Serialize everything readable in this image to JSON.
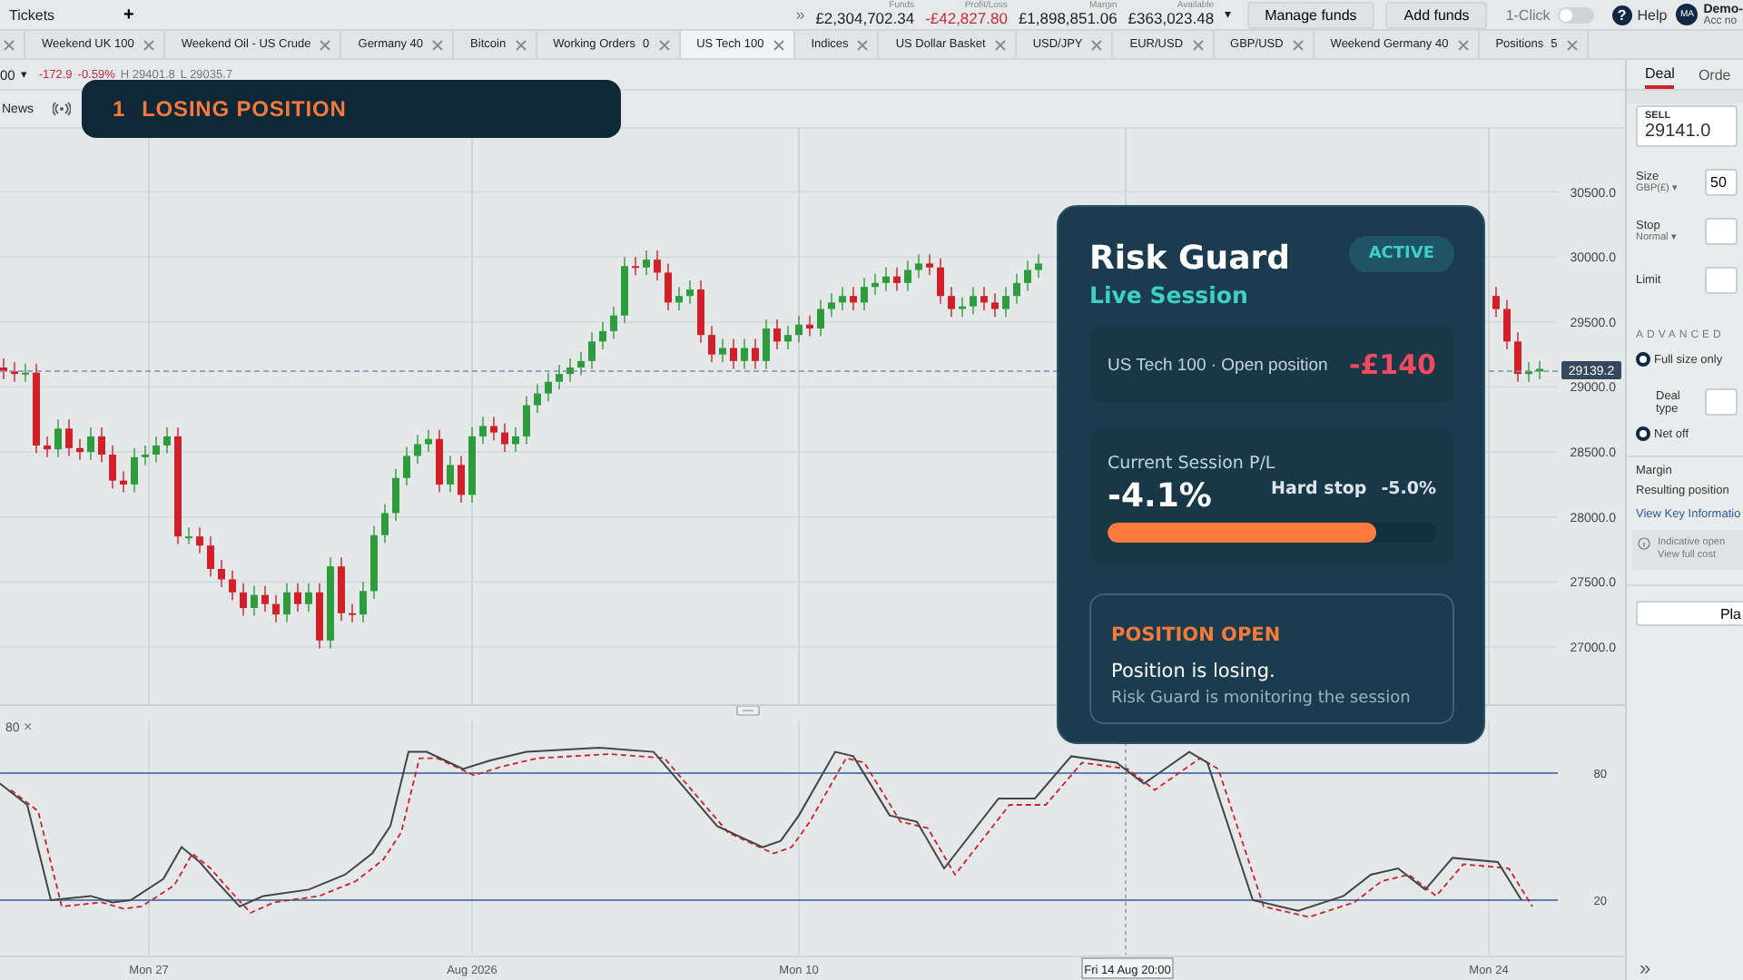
{
  "top_bar": {
    "tickets_label": "Tickets",
    "add_tab": "+",
    "overflow": "»",
    "stats": [
      {
        "label": "Funds",
        "value": "£2,304,702.34",
        "negative": false
      },
      {
        "label": "Profit/Loss",
        "value": "-£42,827.80",
        "negative": true
      },
      {
        "label": "Margin",
        "value": "£1,898,851.06",
        "negative": false
      },
      {
        "label": "Available",
        "value": "£363,023.48",
        "negative": false
      }
    ],
    "stats_caret": "▾",
    "buttons": [
      "Manage funds",
      "Add funds"
    ],
    "one_click": {
      "label": "1-Click",
      "on": false
    },
    "help": {
      "icon": "?",
      "label": "Help"
    },
    "account": {
      "initials": "MA",
      "name": "Demo-",
      "sub": "Acc no"
    }
  },
  "tabs": [
    {
      "label": "Weekend UK 100",
      "selected": false
    },
    {
      "label": "Weekend Oil - US Crude",
      "selected": false
    },
    {
      "label": "Germany 40",
      "selected": false
    },
    {
      "label": "Bitcoin",
      "selected": false
    },
    {
      "label": "Working Orders",
      "count": "0",
      "selected": false
    },
    {
      "label": "US Tech 100",
      "selected": true
    },
    {
      "label": "Indices",
      "selected": false
    },
    {
      "label": "US Dollar Basket",
      "selected": false
    },
    {
      "label": "USD/JPY",
      "selected": false
    },
    {
      "label": "EUR/USD",
      "selected": false
    },
    {
      "label": "GBP/USD",
      "selected": false
    },
    {
      "label": "Weekend Germany 40",
      "selected": false
    },
    {
      "label": "Positions",
      "count": "5",
      "selected": false
    }
  ],
  "instrument_bar": {
    "price_tail": "00",
    "caret": "▾",
    "change": "-172.9",
    "change_pct": "-0.59%",
    "high": "H 29401.8",
    "low": "L 29035.7"
  },
  "chart_toolbar": {
    "news": "News"
  },
  "banner": {
    "number": "1",
    "text": "LOSING POSITION"
  },
  "chart": {
    "chart_data": {
      "type": "candlestick",
      "grid": true,
      "yticks": [
        {
          "value": 30500,
          "label": "30500.0"
        },
        {
          "value": 30000,
          "label": "30000.0"
        },
        {
          "value": 29500,
          "label": "29500.0"
        },
        {
          "value": 29000,
          "label": "29000.0"
        },
        {
          "value": 28500,
          "label": "28500.0"
        },
        {
          "value": 28000,
          "label": "28000.0"
        },
        {
          "value": 27500,
          "label": "27500.0"
        },
        {
          "value": 27000,
          "label": "27000.0"
        }
      ],
      "ylim": [
        26560,
        30986
      ],
      "ohlc": [
        [
          29150,
          29220,
          29060,
          29120
        ],
        [
          29120,
          29190,
          29040,
          29100
        ],
        [
          29100,
          29180,
          29040,
          29110
        ],
        [
          29110,
          29180,
          28490,
          28550
        ],
        [
          28550,
          28620,
          28460,
          28520
        ],
        [
          28520,
          28750,
          28460,
          28680
        ],
        [
          28680,
          28750,
          28470,
          28530
        ],
        [
          28530,
          28600,
          28440,
          28500
        ],
        [
          28500,
          28690,
          28440,
          28620
        ],
        [
          28620,
          28690,
          28420,
          28480
        ],
        [
          28480,
          28550,
          28220,
          28280
        ],
        [
          28280,
          28350,
          28190,
          28250
        ],
        [
          28250,
          28530,
          28190,
          28460
        ],
        [
          28460,
          28550,
          28400,
          28480
        ],
        [
          28480,
          28620,
          28420,
          28550
        ],
        [
          28550,
          28690,
          28490,
          28620
        ],
        [
          28620,
          28690,
          27790,
          27850
        ],
        [
          27850,
          27920,
          27790,
          27850
        ],
        [
          27850,
          27920,
          27720,
          27780
        ],
        [
          27780,
          27850,
          27540,
          27600
        ],
        [
          27600,
          27670,
          27460,
          27520
        ],
        [
          27520,
          27590,
          27360,
          27420
        ],
        [
          27420,
          27490,
          27240,
          27300
        ],
        [
          27300,
          27470,
          27240,
          27400
        ],
        [
          27400,
          27470,
          27270,
          27330
        ],
        [
          27330,
          27400,
          27190,
          27250
        ],
        [
          27250,
          27490,
          27190,
          27420
        ],
        [
          27420,
          27490,
          27270,
          27330
        ],
        [
          27330,
          27490,
          27270,
          27420
        ],
        [
          27420,
          27490,
          26990,
          27050
        ],
        [
          27050,
          27690,
          26990,
          27620
        ],
        [
          27620,
          27690,
          27200,
          27260
        ],
        [
          27260,
          27330,
          27190,
          27250
        ],
        [
          27250,
          27500,
          27190,
          27430
        ],
        [
          27430,
          27930,
          27370,
          27860
        ],
        [
          27860,
          28100,
          27800,
          28030
        ],
        [
          28030,
          28370,
          27970,
          28300
        ],
        [
          28300,
          28540,
          28240,
          28470
        ],
        [
          28470,
          28630,
          28410,
          28560
        ],
        [
          28560,
          28670,
          28500,
          28600
        ],
        [
          28600,
          28670,
          28190,
          28250
        ],
        [
          28250,
          28470,
          28190,
          28400
        ],
        [
          28400,
          28470,
          28110,
          28170
        ],
        [
          28170,
          28690,
          28110,
          28620
        ],
        [
          28620,
          28770,
          28560,
          28700
        ],
        [
          28700,
          28770,
          28590,
          28650
        ],
        [
          28650,
          28720,
          28500,
          28560
        ],
        [
          28560,
          28690,
          28500,
          28620
        ],
        [
          28620,
          28930,
          28560,
          28860
        ],
        [
          28860,
          29020,
          28800,
          28950
        ],
        [
          28950,
          29110,
          28890,
          29040
        ],
        [
          29040,
          29170,
          28980,
          29100
        ],
        [
          29100,
          29220,
          29040,
          29150
        ],
        [
          29150,
          29270,
          29090,
          29200
        ],
        [
          29200,
          29420,
          29140,
          29350
        ],
        [
          29350,
          29500,
          29290,
          29430
        ],
        [
          29430,
          29620,
          29370,
          29550
        ],
        [
          29550,
          30000,
          29490,
          29930
        ],
        [
          29930,
          30000,
          29860,
          29920
        ],
        [
          29920,
          30050,
          29860,
          29980
        ],
        [
          29980,
          30050,
          29820,
          29880
        ],
        [
          29880,
          29950,
          29590,
          29650
        ],
        [
          29650,
          29770,
          29590,
          29700
        ],
        [
          29700,
          29820,
          29640,
          29750
        ],
        [
          29750,
          29820,
          29340,
          29400
        ],
        [
          29400,
          29470,
          29190,
          29250
        ],
        [
          29250,
          29370,
          29190,
          29300
        ],
        [
          29300,
          29370,
          29140,
          29200
        ],
        [
          29200,
          29370,
          29140,
          29300
        ],
        [
          29300,
          29370,
          29140,
          29200
        ],
        [
          29200,
          29520,
          29140,
          29450
        ],
        [
          29450,
          29520,
          29290,
          29350
        ],
        [
          29350,
          29470,
          29290,
          29400
        ],
        [
          29400,
          29550,
          29340,
          29480
        ],
        [
          29480,
          29550,
          29390,
          29450
        ],
        [
          29450,
          29670,
          29390,
          29600
        ],
        [
          29600,
          29720,
          29540,
          29650
        ],
        [
          29650,
          29770,
          29590,
          29700
        ],
        [
          29700,
          29770,
          29590,
          29650
        ],
        [
          29650,
          29840,
          29590,
          29770
        ],
        [
          29770,
          29870,
          29710,
          29800
        ],
        [
          29800,
          29920,
          29740,
          29850
        ],
        [
          29850,
          29920,
          29740,
          29800
        ],
        [
          29800,
          29970,
          29740,
          29900
        ],
        [
          29900,
          30020,
          29840,
          29950
        ],
        [
          29950,
          30020,
          29860,
          29920
        ],
        [
          29920,
          29990,
          29640,
          29700
        ],
        [
          29700,
          29770,
          29540,
          29600
        ],
        [
          29600,
          29690,
          29540,
          29620
        ],
        [
          29620,
          29770,
          29560,
          29700
        ],
        [
          29700,
          29770,
          29590,
          29650
        ],
        [
          29650,
          29720,
          29540,
          29600
        ],
        [
          29600,
          29770,
          29540,
          29700
        ],
        [
          29700,
          29870,
          29640,
          29800
        ],
        [
          29800,
          29970,
          29740,
          29900
        ],
        [
          29900,
          30020,
          29840,
          29950
        ],
        null,
        null,
        null,
        null,
        null,
        null,
        null,
        null,
        null,
        null,
        null,
        null,
        null,
        null,
        null,
        null,
        null,
        null,
        null,
        null,
        null,
        null,
        null,
        null,
        null,
        null,
        null,
        null,
        null,
        null,
        null,
        null,
        null,
        null,
        null,
        null,
        null,
        null,
        null,
        null,
        null,
        [
          29700,
          29770,
          29540,
          29600
        ],
        [
          29600,
          29670,
          29290,
          29350
        ],
        [
          29350,
          29420,
          29040,
          29100
        ],
        [
          29100,
          29190,
          29040,
          29120
        ],
        [
          29120,
          29200,
          29060,
          29140
        ]
      ]
    },
    "current_price": "29139.2",
    "x_labels": [
      {
        "label": "Mon 27",
        "kind": "tick"
      },
      {
        "label": "Aug 2026",
        "kind": "tick"
      },
      {
        "label": "Mon 10",
        "kind": "tick"
      },
      {
        "label": "Fri 14 Aug 20:00",
        "kind": "crosshair"
      },
      {
        "label": "Mon 24",
        "kind": "tick"
      }
    ]
  },
  "oscillator": {
    "title": "80",
    "close": "×",
    "levels": [
      "80",
      "20"
    ]
  },
  "risk_guard": {
    "title": "Risk Guard",
    "status": "ACTIVE",
    "subtitle": "Live Session",
    "position": {
      "label": "US Tech 100 · Open position",
      "pl": "-£140"
    },
    "session": {
      "label": "Current Session P/L",
      "value": "-4.1%",
      "hard_stop_label": "Hard stop",
      "hard_stop_value": "-5.0%",
      "level": 0.82
    },
    "alert": {
      "title": "POSITION OPEN",
      "message": "Position is losing.",
      "detail": "Risk Guard is monitoring the session"
    }
  },
  "deal_ticket": {
    "tabs": [
      {
        "label": "Deal",
        "selected": true
      },
      {
        "label": "Orde",
        "selected": false
      }
    ],
    "direction": "SELL",
    "price": "29141.0",
    "size_label": "Size",
    "size_unit": "GBP(£) ▾",
    "size_value": "50",
    "stop_label": "Stop",
    "stop_type": "Normal ▾",
    "limit_label": "Limit",
    "advanced": "ADVANCED",
    "options": [
      {
        "label": "Full size only",
        "selected": true
      },
      {
        "label": "Net off",
        "selected": true
      }
    ],
    "deal_type": "Deal type",
    "margin": "Margin",
    "resulting": "Resulting position",
    "key_info": "View Key Informatio",
    "notice": [
      "Indicative open",
      "View full cost"
    ],
    "place": "Pla",
    "collapse": "»"
  }
}
